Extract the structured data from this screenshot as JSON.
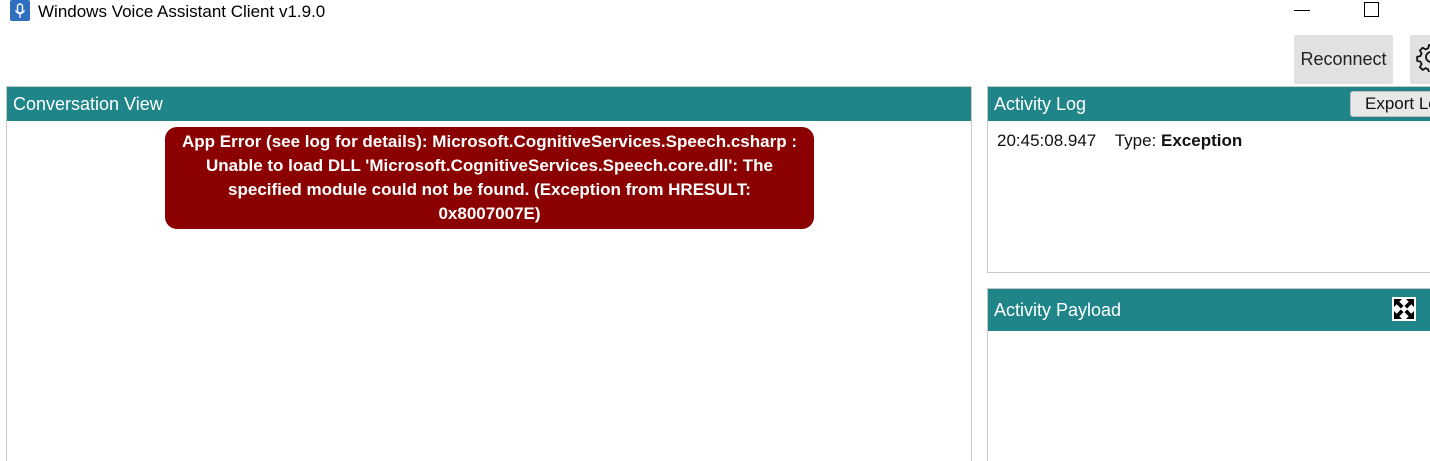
{
  "window": {
    "title": "Windows Voice Assistant Client v1.9.0",
    "icon": "microphone-icon"
  },
  "toolbar": {
    "reconnect_label": "Reconnect",
    "settings_icon": "gear-icon"
  },
  "conversation": {
    "header": "Conversation View",
    "error_message": "App Error (see log for details): Microsoft.CognitiveServices.Speech.csharp : Unable to load DLL 'Microsoft.CognitiveServices.Speech.core.dll': The specified module could not be found. (Exception from HRESULT: 0x8007007E)"
  },
  "activity_log": {
    "header": "Activity Log",
    "export_label": "Export Log",
    "entries": [
      {
        "time": "20:45:08.947",
        "type_label": "Type:",
        "type_value": "Exception"
      }
    ]
  },
  "activity_payload": {
    "header": "Activity Payload",
    "expand_icon": "expand-icon"
  },
  "colors": {
    "header_teal": "#1f8589",
    "error_red": "#8b0000",
    "button_gray": "#e1e1e1"
  }
}
